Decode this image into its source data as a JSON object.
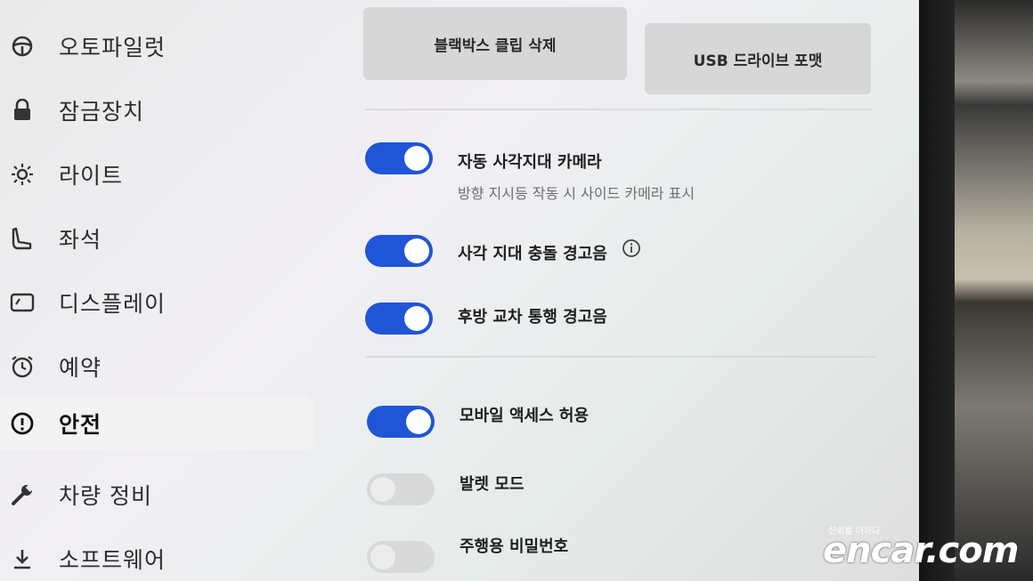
{
  "sidebar": {
    "items": [
      {
        "label": "오토파일럿",
        "icon": "steering-wheel-icon"
      },
      {
        "label": "잠금장치",
        "icon": "lock-icon"
      },
      {
        "label": "라이트",
        "icon": "sun-icon"
      },
      {
        "label": "좌석",
        "icon": "seat-icon"
      },
      {
        "label": "디스플레이",
        "icon": "display-icon"
      },
      {
        "label": "예약",
        "icon": "alarm-clock-icon"
      },
      {
        "label": "안전",
        "icon": "alert-circle-icon"
      },
      {
        "label": "차량 정비",
        "icon": "wrench-icon"
      },
      {
        "label": "소프트웨어",
        "icon": "download-icon"
      }
    ],
    "active_item": "안전"
  },
  "main": {
    "buttons": {
      "delete_clips": "블랙박스 클립 삭제",
      "format_usb": "USB 드라이브 포맷"
    },
    "settings": [
      {
        "title": "자동 사각지대 카메라",
        "subtitle": "방향 지시등 작동 시 사이드 카메라 표시",
        "enabled": true
      },
      {
        "title": "사각 지대 충돌 경고음",
        "info_icon": "info-icon",
        "enabled": true
      },
      {
        "title": "후방 교차 통행 경고음",
        "enabled": true
      },
      {
        "title": "모바일 액세스 허용",
        "enabled": true
      },
      {
        "title": "발렛 모드",
        "enabled": false
      },
      {
        "title": "주행용 비밀번호",
        "enabled": false
      }
    ]
  },
  "watermark": {
    "tagline": "신뢰를 더하다",
    "brand": "encar.com"
  },
  "colors": {
    "toggle_on": "#1f55d6",
    "toggle_off": "#d9d9d9",
    "background": "#ececec"
  }
}
